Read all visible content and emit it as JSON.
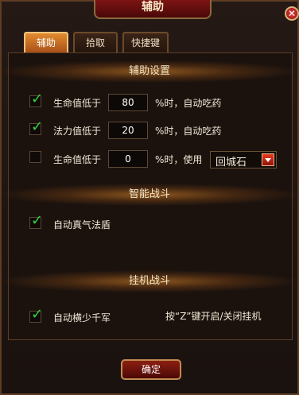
{
  "window": {
    "title": "辅助",
    "close_glyph": "✕"
  },
  "tabs": [
    {
      "label": "辅助",
      "active": true
    },
    {
      "label": "拾取",
      "active": false
    },
    {
      "label": "快捷键",
      "active": false
    }
  ],
  "sections": {
    "assist": {
      "title": "辅助设置",
      "rows": [
        {
          "checked": true,
          "label": "生命值低于",
          "value": "80",
          "suffix": "%时，自动吃药"
        },
        {
          "checked": true,
          "label": "法力值低于",
          "value": "20",
          "suffix": "%时，自动吃药"
        },
        {
          "checked": false,
          "label": "生命值低于",
          "value": "0",
          "suffix": "%时，使用",
          "select_value": "回城石"
        }
      ]
    },
    "smart": {
      "title": "智能战斗",
      "rows": [
        {
          "checked": true,
          "label": "自动真气法盾"
        }
      ]
    },
    "idle": {
      "title": "挂机战斗",
      "rows": [
        {
          "checked": true,
          "label": "自动横少千军"
        }
      ],
      "hint": "按“Z”键开启/关闭挂机"
    }
  },
  "buttons": {
    "confirm": "确定"
  },
  "colors": {
    "accent": "#e18b2f",
    "check": "#34d23c",
    "danger": "#8d1f12"
  }
}
